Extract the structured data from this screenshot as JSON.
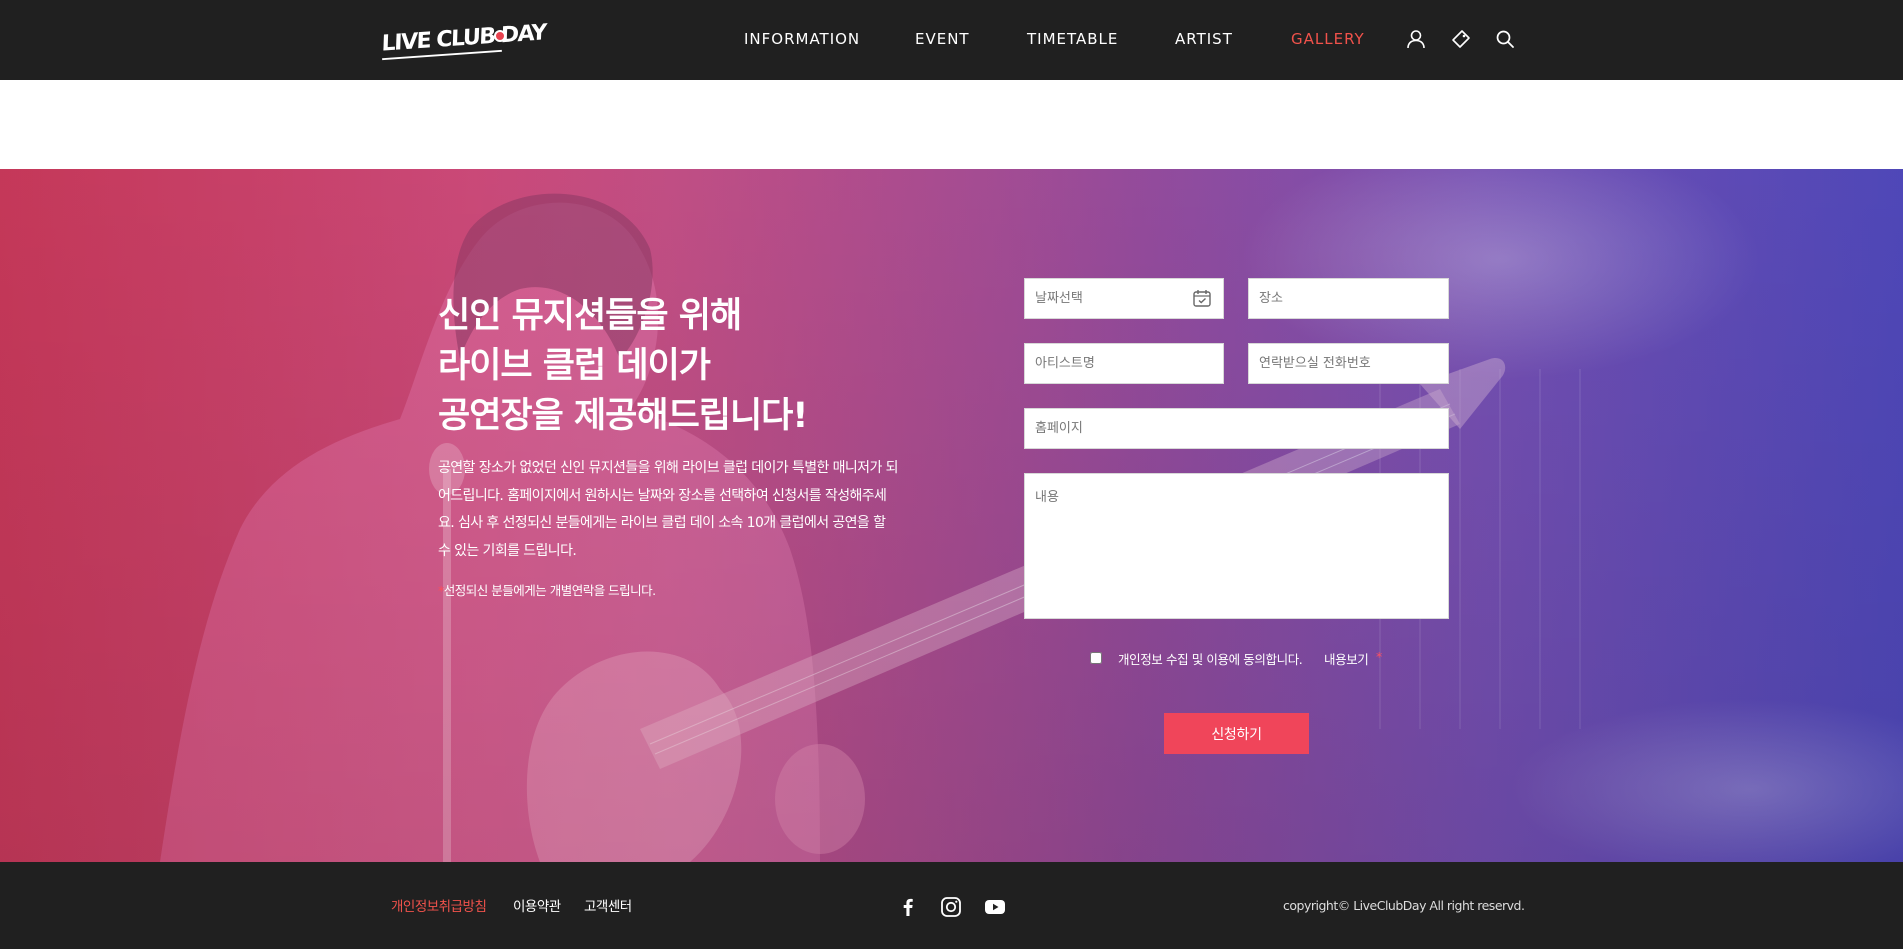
{
  "header": {
    "logo_text": "LIVE CLUB DAY",
    "nav": [
      {
        "label": "INFORMATION",
        "active": false
      },
      {
        "label": "EVENT",
        "active": false
      },
      {
        "label": "TIMETABLE",
        "active": false
      },
      {
        "label": "ARTIST",
        "active": false
      },
      {
        "label": "GALLERY",
        "active": true
      }
    ],
    "icons": [
      "user-icon",
      "ticket-icon",
      "search-icon"
    ]
  },
  "hero": {
    "headline": [
      "신인 뮤지션들을 위해",
      "라이브 클럽 데이가",
      "공연장을 제공해드립니다!"
    ],
    "description": "공연할 장소가 없었던 신인 뮤지션들을 위해 라이브 클럽 데이가 특별한 매니저가 되어드립니다. 홈페이지에서 원하시는 날짜와 장소를 선택하여 신청서를 작성해주세요. 심사 후 선정되신 분들에게는 라이브 클럽 데이 소속 10개 클럽에서 공연을 할 수 있는 기회를 드립니다.",
    "note_mark": "*",
    "note": "선정되신 분들에게는 개별연락을 드립니다."
  },
  "form": {
    "date_placeholder": "날짜선택",
    "place_placeholder": "장소",
    "artist_placeholder": "아티스트명",
    "phone_placeholder": "연락받으실 전화번호",
    "homepage_placeholder": "홈페이지",
    "content_placeholder": "내용",
    "agree_label": "개인정보 수집 및 이용에 동의합니다.",
    "agree_link": "내용보기",
    "agree_required": "*",
    "submit_label": "신청하기"
  },
  "footer": {
    "links": [
      "개인정보취급방침",
      "이용약관",
      "고객센터"
    ],
    "social": [
      "facebook-icon",
      "instagram-icon",
      "youtube-icon"
    ],
    "copyright": "copyright© LiveClubDay All right reservd."
  },
  "colors": {
    "header_bg": "#202020",
    "accent": "#f0524b",
    "button": "#f0455a",
    "gradient_left": "#b83048",
    "gradient_right": "#4e48b4"
  }
}
